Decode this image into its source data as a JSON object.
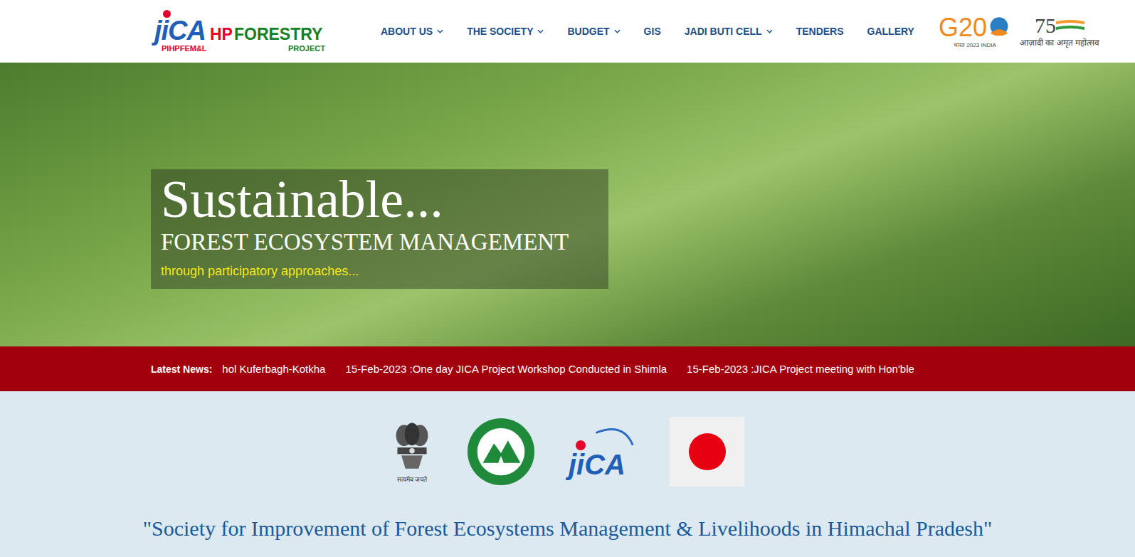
{
  "header": {
    "logo": {
      "brand": "jiCA",
      "hp": "HP",
      "forestry": "FORESTRY",
      "subLeft": "PIHPFEM&L",
      "subRight": "PROJECT"
    },
    "nav": [
      {
        "label": "ABOUT US",
        "dropdown": true
      },
      {
        "label": "THE SOCIETY",
        "dropdown": true
      },
      {
        "label": "BUDGET",
        "dropdown": true
      },
      {
        "label": "GIS",
        "dropdown": false
      },
      {
        "label": "JADI BUTI CELL",
        "dropdown": true
      },
      {
        "label": "TENDERS",
        "dropdown": false
      },
      {
        "label": "GALLERY",
        "dropdown": false
      }
    ],
    "badges": {
      "g20": "G20",
      "g20Sub": "भारत 2023 INDIA",
      "azadiNumber": "75",
      "azadiText": "आज़ादी का अमृत महोत्सव"
    }
  },
  "hero": {
    "title": "Sustainable...",
    "subtitle": "FOREST ECOSYSTEM MANAGEMENT",
    "tagline": "through participatory approaches..."
  },
  "news": {
    "label": "Latest News:",
    "items": [
      "hol Kuferbagh-Kotkha",
      "15-Feb-2023 :One day JICA Project Workshop Conducted in Shimla",
      "15-Feb-2023 :JICA Project meeting with Hon'ble"
    ]
  },
  "partners": {
    "emblemMotto": "सत्यमेव जयते",
    "jica": "jiCA"
  },
  "society": {
    "title": "\"Society for Improvement of Forest Ecosystems Management & Livelihoods in Himachal Pradesh\""
  }
}
